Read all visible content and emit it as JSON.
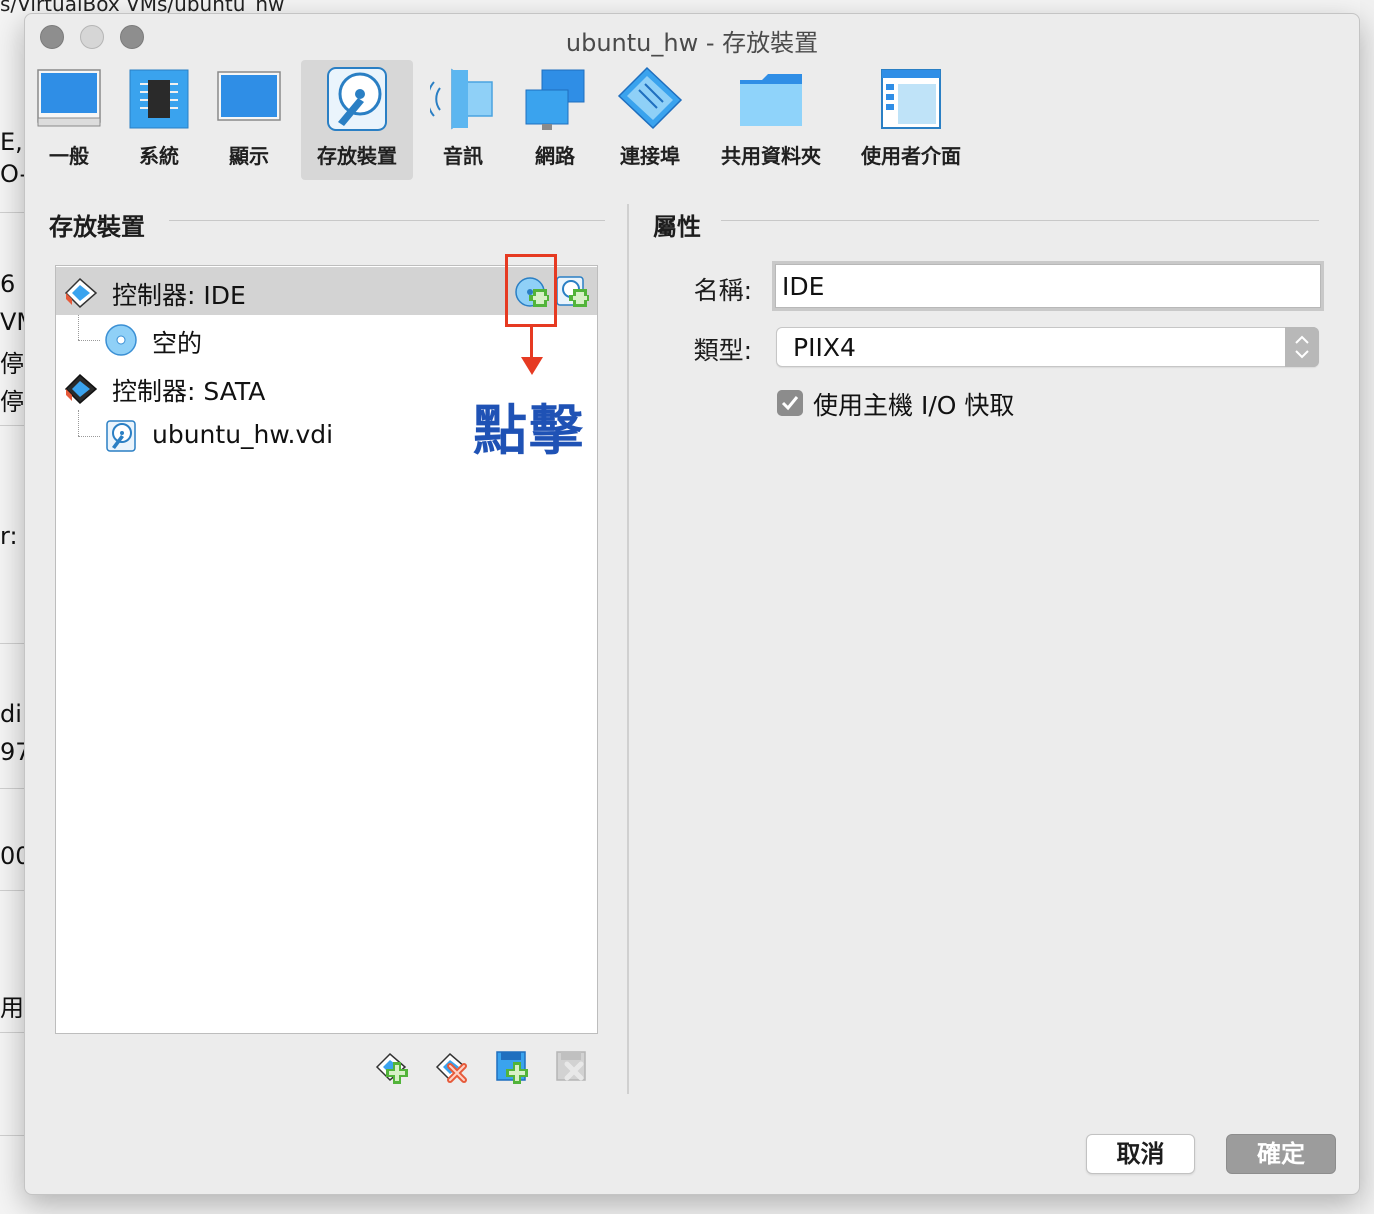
{
  "background_window": {
    "title": "s/VirtualBox VMs/ubuntu_hw",
    "fragments": [
      "E, 硬",
      "O-T",
      "6",
      "VM",
      "停用",
      "停用",
      "r:",
      "di",
      "97",
      "00",
      "用"
    ]
  },
  "window": {
    "title": "ubuntu_hw - 存放裝置"
  },
  "toolbar": {
    "items": [
      {
        "label": "一般",
        "icon": "general-icon"
      },
      {
        "label": "系統",
        "icon": "system-chip-icon"
      },
      {
        "label": "顯示",
        "icon": "display-monitor-icon"
      },
      {
        "label": "存放裝置",
        "icon": "storage-disk-icon",
        "active": true
      },
      {
        "label": "音訊",
        "icon": "audio-speaker-icon"
      },
      {
        "label": "網路",
        "icon": "network-icon"
      },
      {
        "label": "連接埠",
        "icon": "serial-port-icon"
      },
      {
        "label": "共用資料夾",
        "icon": "shared-folder-icon"
      },
      {
        "label": "使用者介面",
        "icon": "user-interface-icon"
      }
    ]
  },
  "storage": {
    "section_title": "存放裝置",
    "tree": {
      "ide_controller": {
        "label": "控制器: IDE",
        "icon": "ide-controller-icon"
      },
      "ide_empty": {
        "label": "空的",
        "icon": "optical-disc-icon"
      },
      "sata_controller": {
        "label": "控制器: SATA",
        "icon": "sata-controller-icon"
      },
      "sata_disk": {
        "label": "ubuntu_hw.vdi",
        "icon": "hard-disk-icon"
      }
    },
    "row_actions": {
      "add_optical": "add-optical-drive-icon",
      "add_hard_disk": "add-hard-disk-icon"
    },
    "annotation": {
      "text": "點擊"
    },
    "bottom_tools": [
      "add-controller-icon",
      "remove-controller-icon",
      "add-attachment-icon",
      "remove-attachment-icon"
    ]
  },
  "attributes": {
    "section_title": "屬性",
    "name_label": "名稱:",
    "name_value": "IDE",
    "type_label": "類型:",
    "type_value": "PIIX4",
    "host_io_cache_label": "使用主機 I/O 快取",
    "host_io_cache_checked": true
  },
  "buttons": {
    "cancel": "取消",
    "ok": "確定"
  },
  "colors": {
    "annotation_red": "#e63a22",
    "annotation_blue": "#1f52b5",
    "icon_blue": "#2f8ee6",
    "add_green": "#52b43a"
  }
}
